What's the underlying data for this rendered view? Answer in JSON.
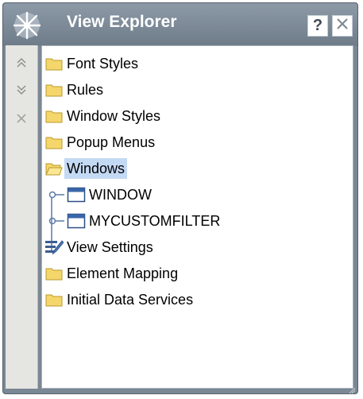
{
  "panel": {
    "title": "View Explorer",
    "help_label": "?",
    "title_icon": "sparkle-logo-icon",
    "close_icon": "close-icon"
  },
  "side_toolbar": {
    "buttons": [
      {
        "name": "move-up-icon"
      },
      {
        "name": "move-down-icon"
      },
      {
        "name": "delete-icon"
      }
    ]
  },
  "tree": {
    "items": [
      {
        "label": "Font Styles",
        "icon": "folder-icon",
        "selected": false
      },
      {
        "label": "Rules",
        "icon": "folder-icon",
        "selected": false
      },
      {
        "label": "Window Styles",
        "icon": "folder-icon",
        "selected": false
      },
      {
        "label": "Popup Menus",
        "icon": "folder-icon",
        "selected": false
      },
      {
        "label": "Windows",
        "icon": "open-folder-icon",
        "selected": true
      },
      {
        "label": "WINDOW",
        "icon": "window-icon",
        "selected": false
      },
      {
        "label": "MYCUSTOMFILTER",
        "icon": "window-icon",
        "selected": false
      },
      {
        "label": "View Settings",
        "icon": "view-settings-icon",
        "selected": false
      },
      {
        "label": "Element Mapping",
        "icon": "folder-icon",
        "selected": false
      },
      {
        "label": "Initial Data Services",
        "icon": "folder-icon",
        "selected": false
      }
    ]
  },
  "colors": {
    "title_bar": "#7a8794",
    "selection": "#c4d9f3",
    "folder": "#f5d66b"
  }
}
